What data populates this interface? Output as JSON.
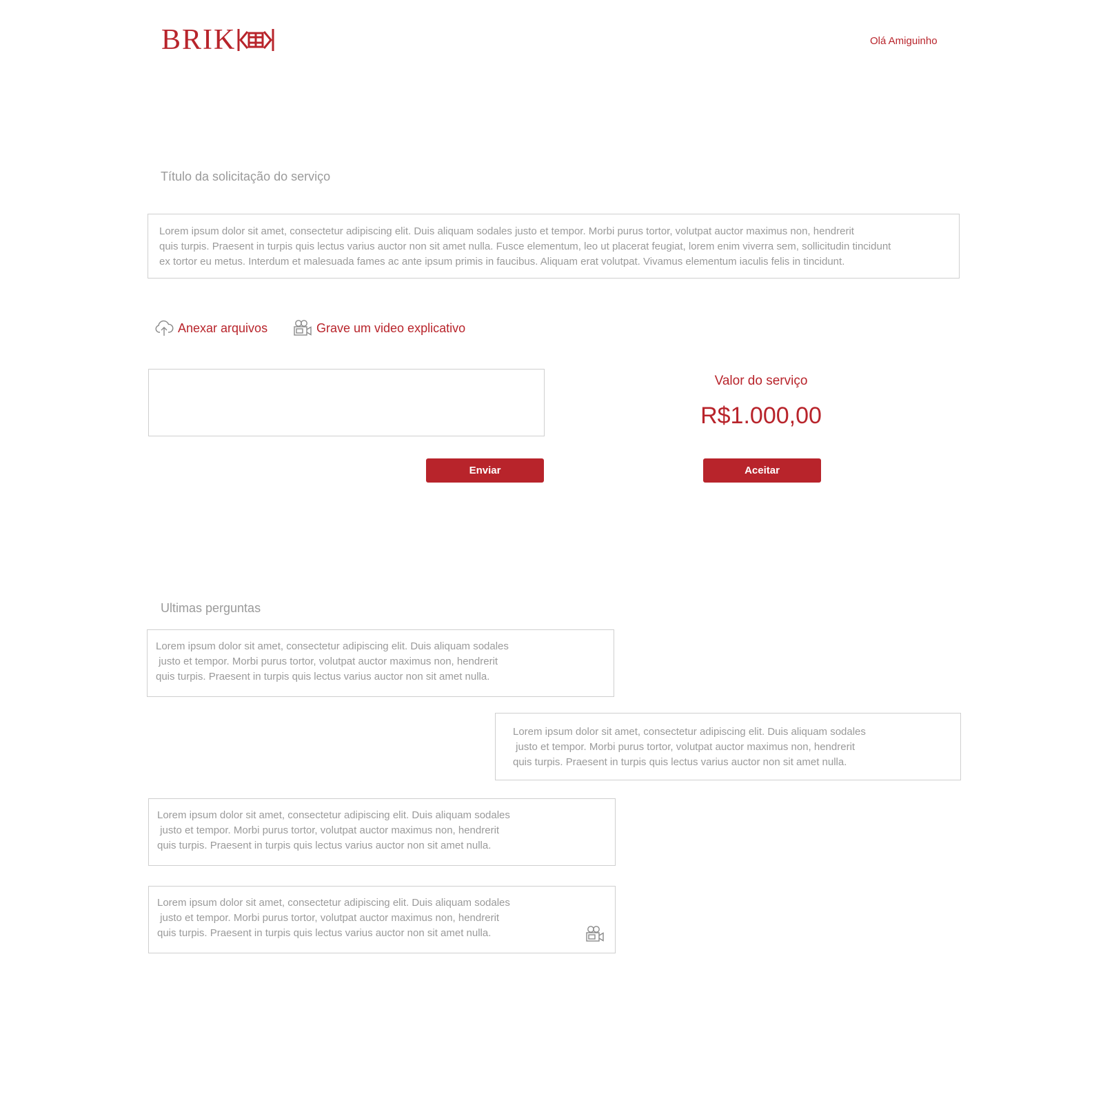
{
  "header": {
    "logo_text": "BRIK",
    "greeting": "Olá Amiguinho"
  },
  "request": {
    "title": "Título da solicitação do serviço",
    "description_lines": [
      "Lorem ipsum dolor sit amet, consectetur adipiscing elit. Duis aliquam sodales justo et tempor. Morbi purus tortor, volutpat auctor maximus non, hendrerit",
      "quis turpis. Praesent in turpis quis lectus varius auctor non sit amet nulla. Fusce elementum, leo ut placerat feugiat, lorem enim viverra sem, sollicitudin tincidunt",
      "ex tortor eu metus. Interdum et malesuada fames ac ante ipsum primis in faucibus. Aliquam erat volutpat. Vivamus elementum iaculis felis in tincidunt."
    ]
  },
  "actions": {
    "attach_label": "Anexar arquivos",
    "attach_icon": "cloud-upload-icon",
    "video_label": "Grave um video explicativo",
    "video_icon": "video-camera-icon"
  },
  "message": {
    "value": "",
    "send_label": "Enviar"
  },
  "price": {
    "label": "Valor do serviço",
    "value": "R$1.000,00",
    "accept_label": "Aceitar"
  },
  "questions": {
    "title": "Ultimas perguntas",
    "items": [
      {
        "lines": [
          "Lorem ipsum dolor sit amet, consectetur adipiscing elit. Duis aliquam sodales",
          " justo et tempor. Morbi purus tortor, volutpat auctor maximus non, hendrerit",
          "quis turpis. Praesent in turpis quis lectus varius auctor non sit amet nulla."
        ]
      },
      {
        "lines": [
          "Lorem ipsum dolor sit amet, consectetur adipiscing elit. Duis aliquam sodales",
          " justo et tempor. Morbi purus tortor, volutpat auctor maximus non, hendrerit",
          "quis turpis. Praesent in turpis quis lectus varius auctor non sit amet nulla."
        ]
      },
      {
        "lines": [
          "Lorem ipsum dolor sit amet, consectetur adipiscing elit. Duis aliquam sodales",
          " justo et tempor. Morbi purus tortor, volutpat auctor maximus non, hendrerit",
          "quis turpis. Praesent in turpis quis lectus varius auctor non sit amet nulla."
        ]
      },
      {
        "lines": [
          "Lorem ipsum dolor sit amet, consectetur adipiscing elit. Duis aliquam sodales",
          " justo et tempor. Morbi purus tortor, volutpat auctor maximus non, hendrerit",
          "quis turpis. Praesent in turpis quis lectus varius auctor non sit amet nulla."
        ],
        "icon": "video-camera-icon"
      }
    ]
  },
  "colors": {
    "brand": "#b8242b",
    "text_muted": "#9a9a9a",
    "border": "#cfcfcf"
  }
}
